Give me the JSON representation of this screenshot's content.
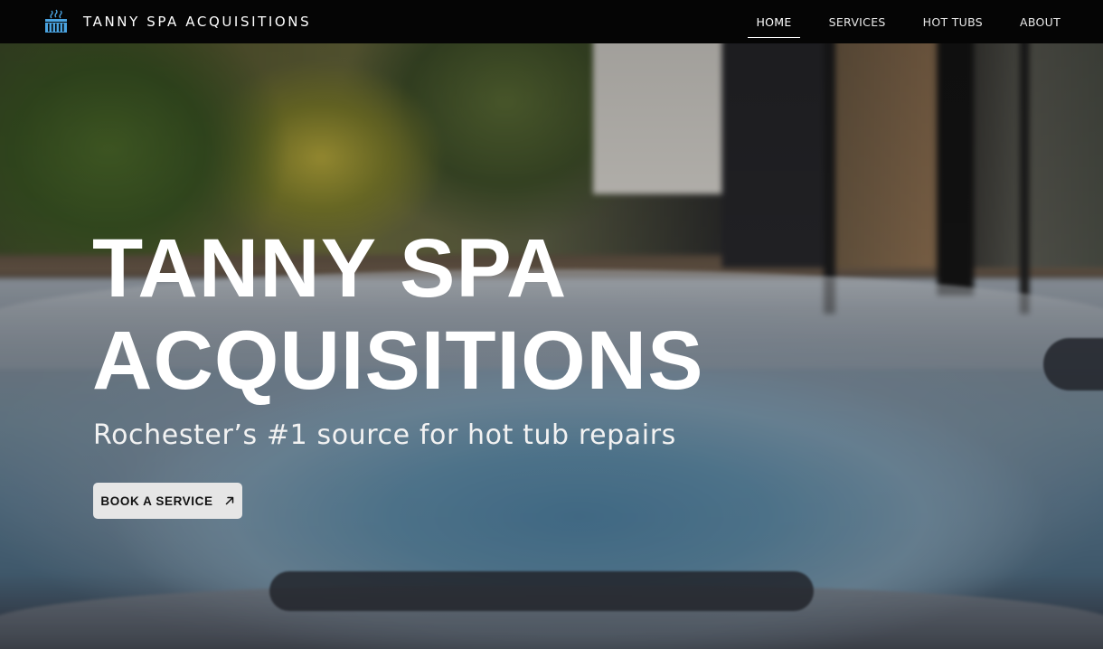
{
  "brand": {
    "name": "TANNY SPA ACQUISITIONS",
    "logo_icon": "hot-tub-icon",
    "logo_color": "#4aa3e0"
  },
  "nav": {
    "items": [
      {
        "label": "HOME",
        "active": true
      },
      {
        "label": "SERVICES",
        "active": false
      },
      {
        "label": "HOT TUBS",
        "active": false
      },
      {
        "label": "ABOUT",
        "active": false
      }
    ]
  },
  "hero": {
    "title_line1": "TANNY SPA",
    "title_line2": "ACQUISITIONS",
    "subtitle": "Rochester’s #1 source for hot tub repairs",
    "cta_label": "BOOK A SERVICE",
    "cta_icon": "arrow-up-right-icon",
    "background": "hot-tub-photo"
  }
}
